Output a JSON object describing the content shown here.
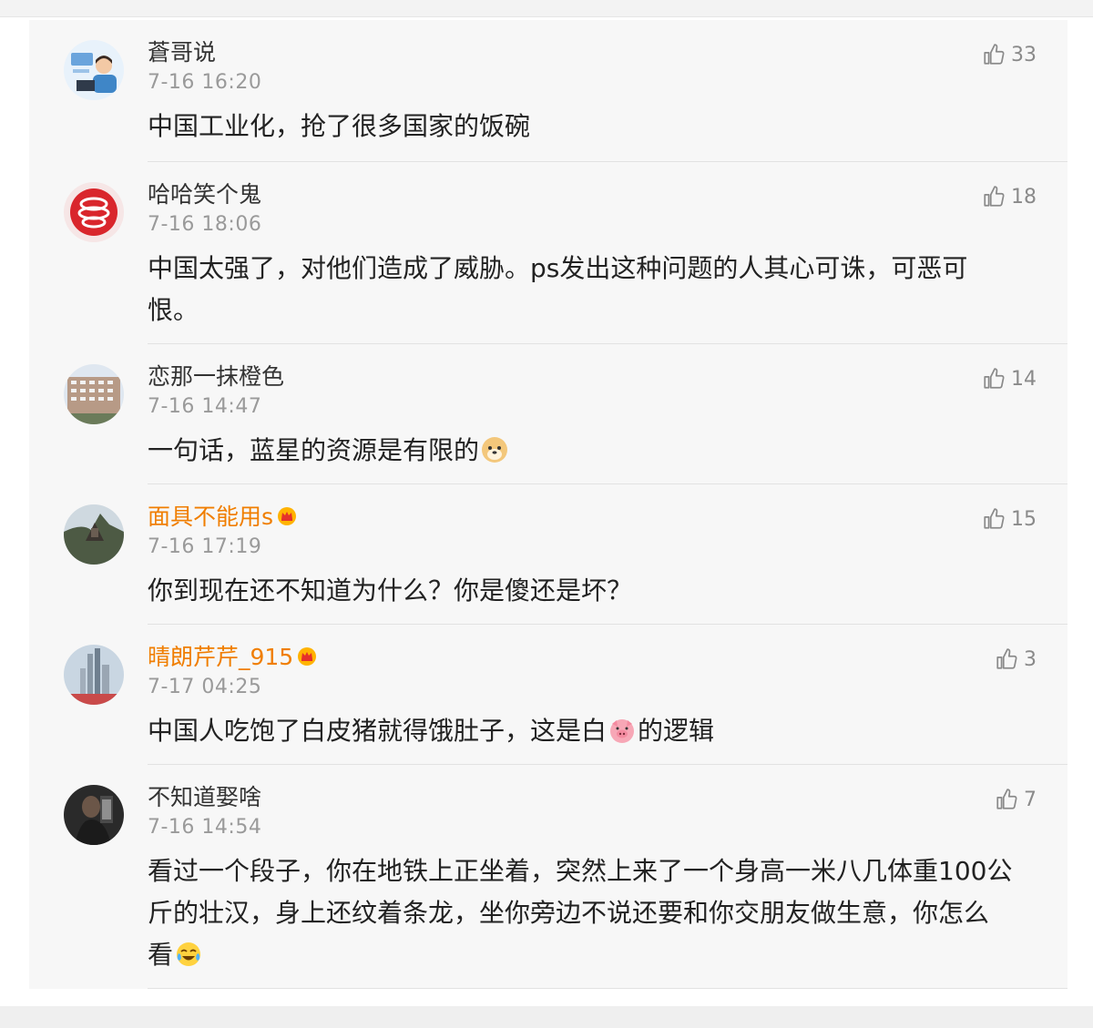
{
  "comments": [
    {
      "user": "蒼哥说",
      "time": "7-16 16:20",
      "likes": "33",
      "text": "中国工业化，抢了很多国家的饭碗",
      "tail": ""
    },
    {
      "user": "哈哈笑个鬼",
      "time": "7-16 18:06",
      "likes": "18",
      "text": "中国太强了，对他们造成了威胁。ps发出这种问题的人其心可诛，可恶可恨。",
      "tail": ""
    },
    {
      "user": "恋那一抹橙色",
      "time": "7-16 14:47",
      "likes": "14",
      "text": "一句话，蓝星的资源是有限的",
      "tail": ""
    },
    {
      "user": "面具不能用s",
      "time": "7-16 17:19",
      "likes": "15",
      "text": "你到现在还不知道为什么？你是傻还是坏？",
      "tail": ""
    },
    {
      "user": "晴朗芹芹_915",
      "time": "7-17 04:25",
      "likes": "3",
      "text": "中国人吃饱了白皮猪就得饿肚子，这是白",
      "tail": "的逻辑"
    },
    {
      "user": "不知道娶啥",
      "time": "7-16 14:54",
      "likes": "7",
      "text": "看过一个段子，你在地铁上正坐着，突然上来了一个身高一米八几体重100公斤的壮汉，身上还纹着条龙，坐你旁边不说还要和你交朋友做生意，你怎么看",
      "tail": ""
    }
  ],
  "icons": {
    "like": "thumbs-up-icon",
    "vip": "crown-icon",
    "doge": "doge-emoji-icon",
    "pig": "pig-emoji-icon",
    "laugh": "laugh-cry-emoji-icon"
  },
  "colors": {
    "vip_name": "#f07e00",
    "normal_name": "#333333",
    "meta": "#9a9a9a"
  }
}
